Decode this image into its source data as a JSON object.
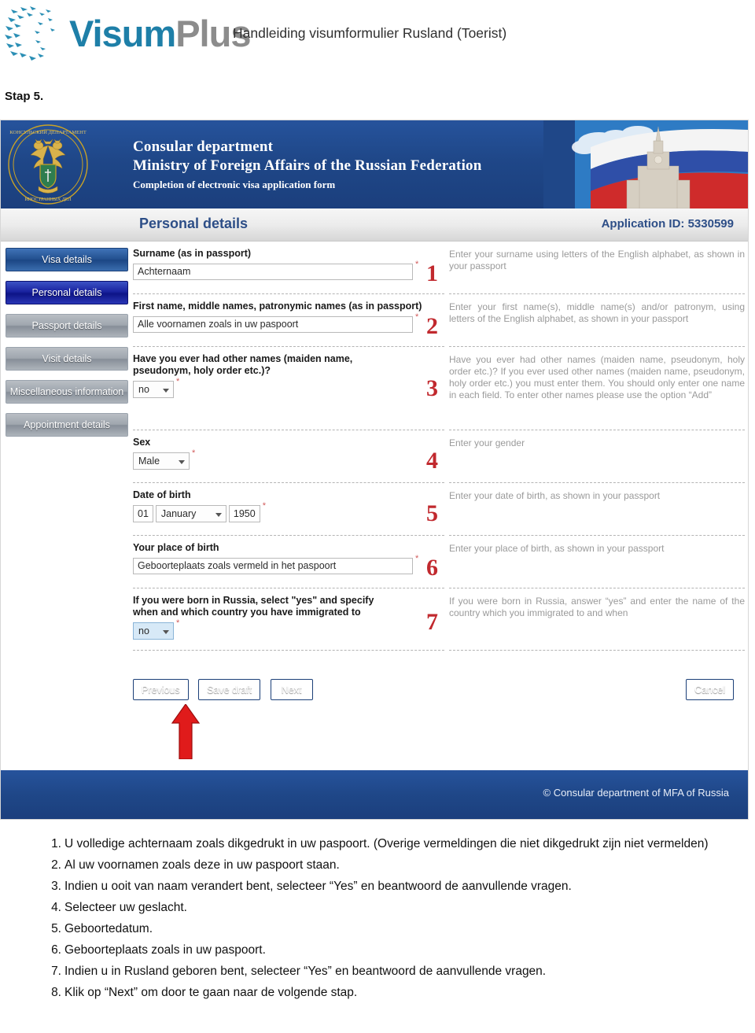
{
  "doc": {
    "logo_visum": "Visum",
    "logo_plus": "Plus",
    "logo_birds_icon": "birds-logo-icon",
    "subtitle": "Handleiding visumformulier Rusland (Toerist)",
    "step_label": "Stap 5."
  },
  "screenshot": {
    "banner": {
      "emblem_icon": "russian-mfa-emblem-icon",
      "flag_icon": "russian-flag-building-icon",
      "line1": "Consular department",
      "line2": "Ministry of Foreign Affairs of the Russian Federation",
      "line3": "Completion of electronic visa application form"
    },
    "section_bar": {
      "title": "Personal details",
      "application_id": "Application ID: 5330599"
    },
    "sidebar": {
      "items": [
        {
          "label": "Visa details",
          "state": "blue"
        },
        {
          "label": "Personal details",
          "state": "active"
        },
        {
          "label": "Passport details",
          "state": "grey"
        },
        {
          "label": "Visit details",
          "state": "grey"
        },
        {
          "label": "Miscellaneous information",
          "state": "grey"
        },
        {
          "label": "Appointment details",
          "state": "grey"
        }
      ]
    },
    "fields": [
      {
        "marker": "1",
        "label": "Surname (as in passport)",
        "value": "Achternaam",
        "required_mark": "*",
        "help": "Enter your surname using letters of the English alphabet, as shown in your passport"
      },
      {
        "marker": "2",
        "label": "First name, middle names, patronymic names (as in passport)",
        "value": "Alle voornamen zoals in uw paspoort",
        "required_mark": "*",
        "help": "Enter your first name(s), middle name(s) and/or patronym, using letters of the English alphabet, as shown in your passport"
      },
      {
        "marker": "3",
        "label": "Have you ever had other names (maiden name, pseudonym, holy order etc.)?",
        "value": "no",
        "required_mark": "*",
        "help": "Have you ever had other names (maiden name, pseudonym, holy order etc.)? If you ever used other names (maiden name, pseudonym, holy order etc.) you must enter them. You should only enter one name in each field. To enter other names please use the option “Add”"
      },
      {
        "marker": "4",
        "label": "Sex",
        "value": "Male",
        "required_mark": "*",
        "help": "Enter your gender"
      },
      {
        "marker": "5",
        "label": "Date of birth",
        "day": "01",
        "month": "January",
        "year": "1950",
        "required_mark": "*",
        "help": "Enter your date of birth, as shown in your passport"
      },
      {
        "marker": "6",
        "label": "Your place of birth",
        "value": "Geboorteplaats zoals vermeld in het paspoort",
        "required_mark": "*",
        "help": "Enter your place of birth, as shown in your passport"
      },
      {
        "marker": "7",
        "label": "If you were born in Russia, select \"yes\" and specify when and which country you have immigrated to",
        "value": "no",
        "required_mark": "*",
        "help": "If you were born in Russia, answer “yes” and enter the name of the country which you immigrated to and when"
      }
    ],
    "buttons": {
      "previous": "Previous",
      "save_draft": "Save draft",
      "next": "Next",
      "cancel": "Cancel"
    },
    "annotation": {
      "arrow_icon": "red-up-arrow-icon",
      "color": "#e01b1b"
    },
    "footer": {
      "copyright": "© Consular department of MFA of Russia"
    }
  },
  "instructions": [
    {
      "num": "1.",
      "text": "U volledige achternaam zoals dikgedrukt in uw paspoort. (Overige vermeldingen die niet dikgedrukt zijn niet vermelden)"
    },
    {
      "num": "2.",
      "text": "Al uw voornamen zoals deze in uw paspoort staan."
    },
    {
      "num": "3.",
      "text": "Indien u ooit van naam verandert bent, selecteer “Yes” en beantwoord de aanvullende vragen."
    },
    {
      "num": "4.",
      "text": "Selecteer uw geslacht."
    },
    {
      "num": "5.",
      "text": "Geboortedatum."
    },
    {
      "num": "6.",
      "text": "Geboorteplaats zoals in uw paspoort."
    },
    {
      "num": "7.",
      "text": "Indien u in Rusland geboren bent, selecteer “Yes” en beantwoord de aanvullende vragen."
    },
    {
      "num": "8.",
      "text": "Klik op “Next” om door te gaan naar de volgende stap."
    }
  ],
  "colors": {
    "brand_blue": "#1e7fa8",
    "brand_grey": "#8c8c8c",
    "banner_blue": "#1f4788",
    "marker_red": "#c1292e",
    "arrow_red": "#e01b1b",
    "section_title_blue": "#2d4e87"
  }
}
